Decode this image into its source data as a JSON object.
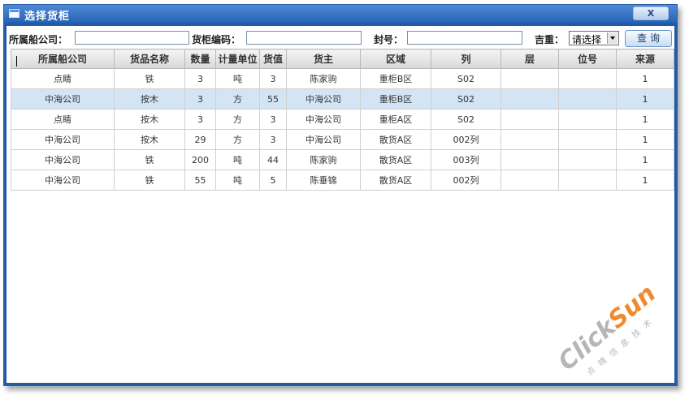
{
  "window": {
    "title": "选择货柜",
    "close_label": "X"
  },
  "toolbar": {
    "company_label": "所属船公司：",
    "company_value": "",
    "container_label": "货柜编码：",
    "container_value": "",
    "seal_label": "封号：",
    "seal_value": "",
    "weight_label": "吉重：",
    "weight_select": "请选择",
    "query_label": "查询"
  },
  "table": {
    "columns": [
      "所属船公司",
      "货品名称",
      "数量",
      "计量单位",
      "货值",
      "货主",
      "区域",
      "列",
      "层",
      "位号",
      "来源"
    ],
    "rows": [
      [
        "点睛",
        "铁",
        "3",
        "吨",
        "3",
        "陈家驹",
        "重柜B区",
        "S02",
        "",
        "",
        "1"
      ],
      [
        "中海公司",
        "按木",
        "3",
        "方",
        "55",
        "中海公司",
        "重柜B区",
        "S02",
        "",
        "",
        "1"
      ],
      [
        "点睛",
        "按木",
        "3",
        "方",
        "3",
        "中海公司",
        "重柜A区",
        "S02",
        "",
        "",
        "1"
      ],
      [
        "中海公司",
        "按木",
        "29",
        "方",
        "3",
        "中海公司",
        "散货A区",
        "002列",
        "",
        "",
        "1"
      ],
      [
        "中海公司",
        "铁",
        "200",
        "吨",
        "44",
        "陈家驹",
        "散货A区",
        "003列",
        "",
        "",
        "1"
      ],
      [
        "中海公司",
        "铁",
        "55",
        "吨",
        "5",
        "陈垂锦",
        "散货A区",
        "002列",
        "",
        "",
        "1"
      ]
    ],
    "selected_row": 1
  },
  "watermark": {
    "brand": "ClickSun",
    "subtitle": "点晴信息技术"
  },
  "colors": {
    "title_bar": "#2863b4",
    "selected_row": "#d3e4f4",
    "watermark_orange": "#f08a2c",
    "watermark_gray": "#b5b5b5"
  }
}
